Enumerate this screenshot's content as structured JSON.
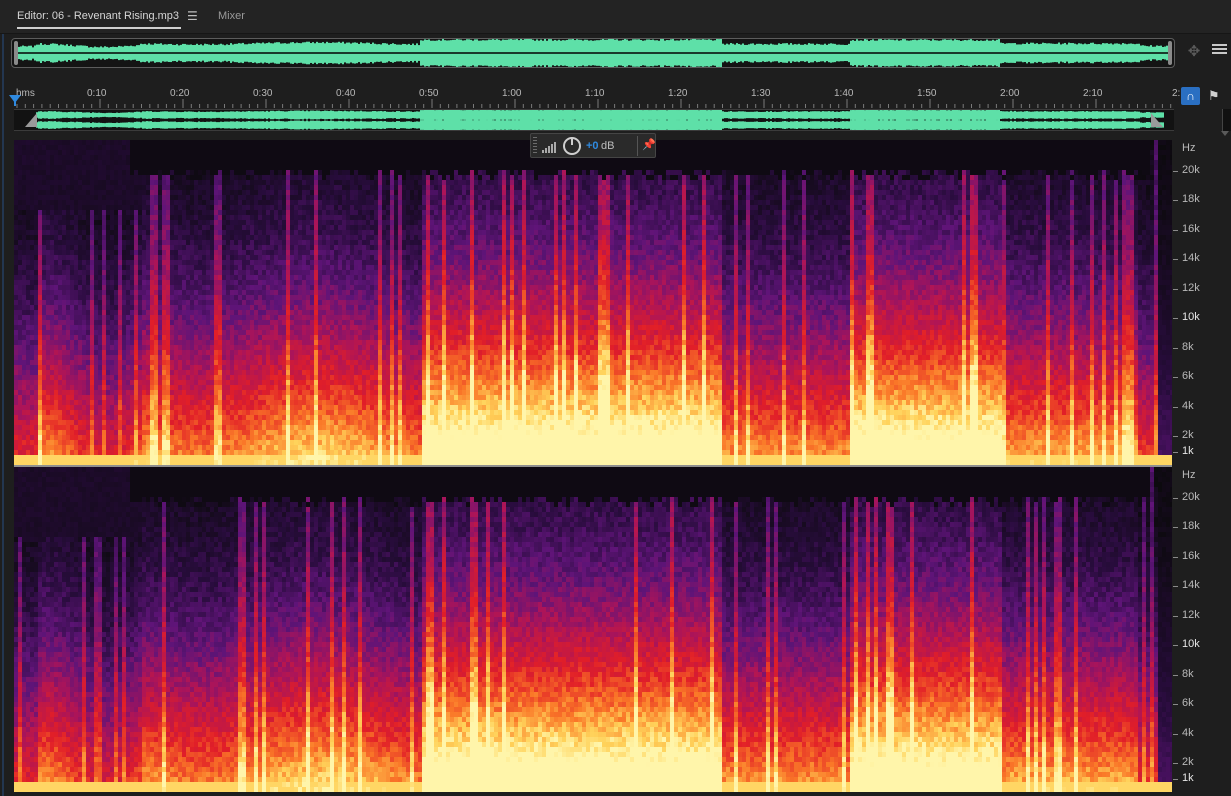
{
  "tabs": {
    "editor_label": "Editor: 06 - Revenant Rising.mp3",
    "editor_menu_glyph": "☰",
    "mixer_label": "Mixer"
  },
  "toolbar": {
    "zoom_icon": "zoom-navigator-icon",
    "panel_menu_icon": "panel-menu-icon",
    "snap_icon": "snap-to-playhead-icon",
    "marker_icon": "marker-pin-icon"
  },
  "timeline": {
    "time_format": "hms",
    "ticks": [
      "0:10",
      "0:20",
      "0:30",
      "0:40",
      "0:50",
      "1:00",
      "1:10",
      "1:20",
      "1:30",
      "1:40",
      "1:50",
      "2:00",
      "2:10",
      "2:"
    ]
  },
  "hud": {
    "gain_value": "+0",
    "gain_unit": "dB",
    "pin_icon": "pin-icon",
    "knob_icon": "volume-knob-icon"
  },
  "frequency_axis": {
    "unit": "Hz",
    "labels": [
      "20k",
      "18k",
      "16k",
      "14k",
      "12k",
      "10k",
      "8k",
      "6k",
      "4k",
      "2k",
      "1k"
    ],
    "emphasized": [
      "10k",
      "1k"
    ]
  },
  "channels": [
    "left",
    "right"
  ],
  "colors": {
    "accent_blue": "#2f8ae0",
    "waveform_green": "#5ee0a8",
    "spectrum_low": "#14071f",
    "spectrum_mid": "#d0202a",
    "spectrum_high": "#ffe27a"
  }
}
